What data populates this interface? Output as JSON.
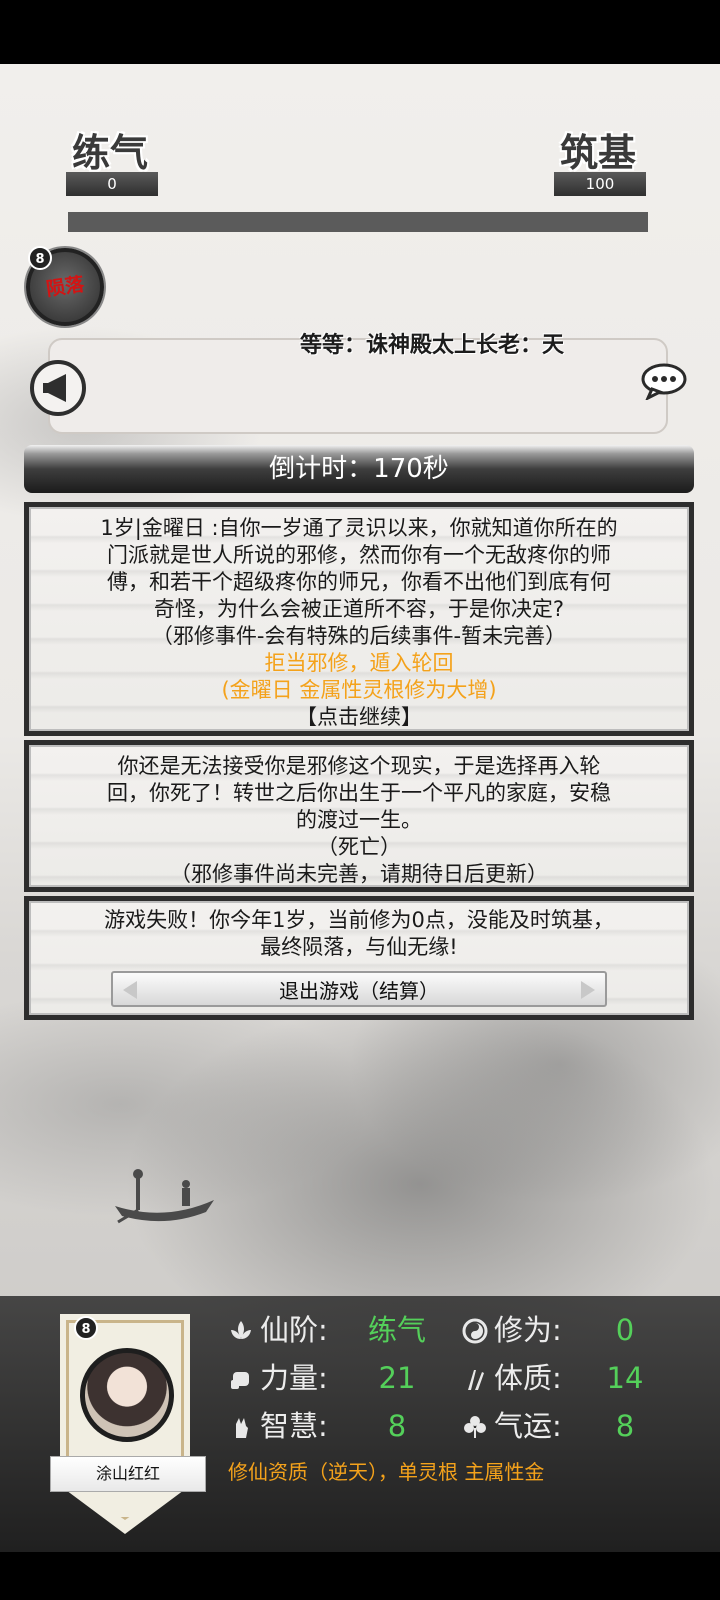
{
  "realm": {
    "current_name": "练气",
    "current_value": "0",
    "next_name": "筑基",
    "next_value": "100",
    "progress": 0
  },
  "fallen": {
    "level": "8",
    "stamp": "陨落"
  },
  "broadcast": {
    "ticker_text": "等等：诛神殿太上长老：天",
    "message": ""
  },
  "countdown": {
    "text": "倒计时：170秒"
  },
  "event1": {
    "line1": "1岁|金曜日 :自你一岁通了灵识以来，你就知道你所在的",
    "line2": "门派就是世人所说的邪修，然而你有一个无敌疼你的师",
    "line3": "傅，和若干个超级疼你的师兄，你看不出他们到底有何",
    "line4": "奇怪，为什么会被正道所不容，于是你决定?",
    "note": "（邪修事件-会有特殊的后续事件-暂未完善）",
    "choice": "拒当邪修，遁入轮回",
    "choice_effect": "(金曜日 金属性灵根修为大增)",
    "continue": "【点击继续】"
  },
  "event2": {
    "line1": "你还是无法接受你是邪修这个现实，于是选择再入轮",
    "line2": "回，你死了！转世之后你出生于一个平凡的家庭，安稳",
    "line3": "的渡过一生。",
    "result": "（死亡）",
    "note": "（邪修事件尚未完善，请期待日后更新）"
  },
  "event3": {
    "line1": "游戏失败！你今年1岁，当前修为0点，没能及时筑基，",
    "line2": "最终陨落，与仙无缘!",
    "exit_button": "退出游戏（结算）"
  },
  "character": {
    "level": "8",
    "name": "涂山红红",
    "stats": {
      "realm_label": "仙阶:",
      "realm_value": "练气",
      "cultivation_label": "修为:",
      "cultivation_value": "0",
      "strength_label": "力量:",
      "strength_value": "21",
      "constitution_label": "体质:",
      "constitution_value": "14",
      "wisdom_label": "智慧:",
      "wisdom_value": "8",
      "luck_label": "气运:",
      "luck_value": "8"
    },
    "aptitude": "修仙资质（逆天），单灵根 主属性金"
  },
  "colors": {
    "choice_orange": "#f4a21b",
    "stat_green": "#54d05a",
    "fallen_red": "#d21414"
  },
  "icons": [
    "megaphone-icon",
    "chat-bubble-icon",
    "lotus-icon",
    "swirl-icon",
    "fist-icon",
    "sparkle-icon",
    "hand-gesture-icon",
    "clover-icon"
  ]
}
